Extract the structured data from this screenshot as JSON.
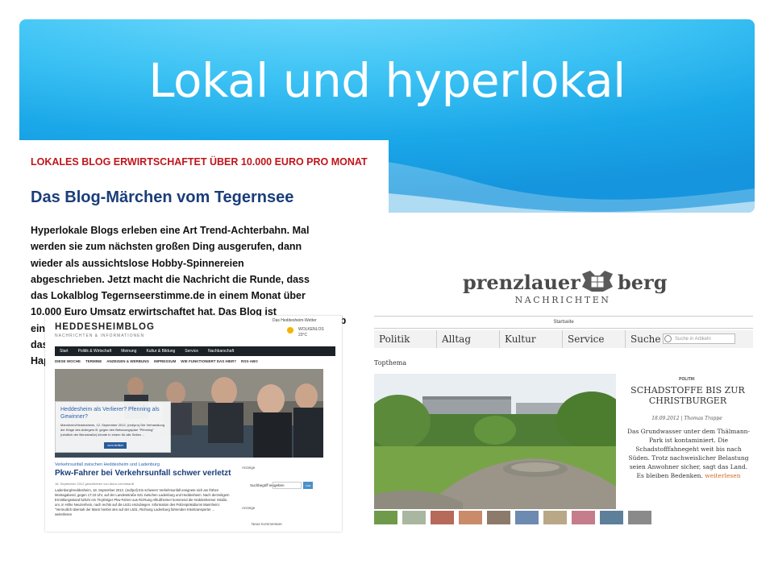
{
  "slide": {
    "title": "Lokal und hyperlokal",
    "colors": {
      "banner": "#1aa7e8",
      "title": "#ffffff"
    }
  },
  "article": {
    "kicker": "LOKALES BLOG ERWIRTSCHAFTET ÜBER 10.000 EURO PRO MONAT",
    "headline": "Das Blog-Märchen vom Tegernsee",
    "body_lines": [
      "Hyperlokale Blogs erleben eine Art Trend-Achterbahn. Mal",
      "werden sie zum nächsten großen Ding ausgerufen, dann",
      "wieder als aussichtslose Hobby-Spinnereien",
      "abgeschrieben. Jetzt macht die Nachricht die Runde, dass",
      "das Lokalblog Tegernseerstimme.de in einem Monat über",
      "10.000 Euro Umsatz erwirtschaftet hat. Das Blog ist",
      "ein",
      "das",
      "Hap"
    ],
    "body_tail_right": [
      "ob",
      "n"
    ],
    "colors": {
      "kicker": "#c0151b",
      "headline": "#1a3d7a"
    }
  },
  "heddesheim": {
    "logo": "HEDDESHEIMBLOG",
    "subtitle": "NACHRICHTEN & INFORMATIONEN",
    "weather_label": "Das Heddesheim-Wetter",
    "weather_temp": "WOLKENLOS",
    "weather_deg": "23°C",
    "nav": [
      "Start",
      "Politik & Wirtschaft",
      "Meinung",
      "Kultur & Bildung",
      "Service",
      "Nachbarschaft"
    ],
    "subnav": [
      "DIESE WOCHE",
      "TERMINE",
      "ANZEIGEN & WERBUNG",
      "IMPRESSUM",
      "WIE FUNKTIONIERT DAS HIER?",
      "RSS-ABO"
    ],
    "teaser_title": "Heddesheim als Verlierer? Pfenning als Gewinner?",
    "teaser_text": "Mannheim/Heddesheim, 12. September 2012. (red/pro) Die Verhandlung der Klage des Anliegers B. gegen den Bebauungsplan \"Pfenning\" (nördlich der Benzstraße) könnte in einem für alle Seiten ...",
    "teaser_button": "zum Artikel",
    "category": "Verkehrsunfall zwischen Heddesheim und Ladenburg",
    "headline": "Pkw-Fahrer bei Verkehrsunfall schwer verletzt",
    "meta": "18. September 2012 geschrieben von Alma Lemmhardt",
    "text": "Ladenburg/Heddesheim, 18. September 2012. (red/pol) Ein schwerer Verkehrsunfall ereignete sich am frühen Montagabend, gegen 17:10 Uhr, auf der Landesstraße 631 zwischen Ladenburg und Heddesheim. Nach derzeitigem Ermittlungsstand befuhr ein 75-jähriger Pkw-Fahrer aus Richtung Altlußheimer kommend die Heddesheimer Straße, um, in Höhe Neuzenhein, nach rechts auf die L631 einzubiegen. Information des Polizeipräsidiums Mannheim: \"Vermutlich übersah der Mann hierbei den auf der L631, Richtung Ladenburg fahrenden Kleintransporter ... weiterlesen",
    "side_anzeige": "Anzeige",
    "side_search": "Suchbegriff eingeben",
    "side_button": "Los",
    "side_anzeige2": "Anzeige",
    "side_comments": "Neue Kommentare"
  },
  "prenzlauer": {
    "logo_left": "prenzlauer",
    "logo_right": "berg",
    "logo_sub": "NACHRICHTEN",
    "start": "Startseite",
    "nav": [
      "Politik",
      "Alltag",
      "Kultur",
      "Service",
      "Suche"
    ],
    "search_placeholder": "Suche in Artikeln",
    "topthema": "Topthema",
    "category": "POLITIK",
    "headline": "SCHADSTOFFE BIS ZUR CHRISTBURGER",
    "date": "18.09.2012 | Thomas Trappe",
    "text": "Das Grundwasser unter dem Thälmann-Park ist kontaminiert. Die Schadstofffahnegeht weit bis nach Süden. Trotz nachweislicher Belastung seien Anwohner sicher, sagt das Land. Es bleiben Bedenken.",
    "more": "weiterlesen",
    "colors": {
      "more": "#d2691e"
    }
  }
}
